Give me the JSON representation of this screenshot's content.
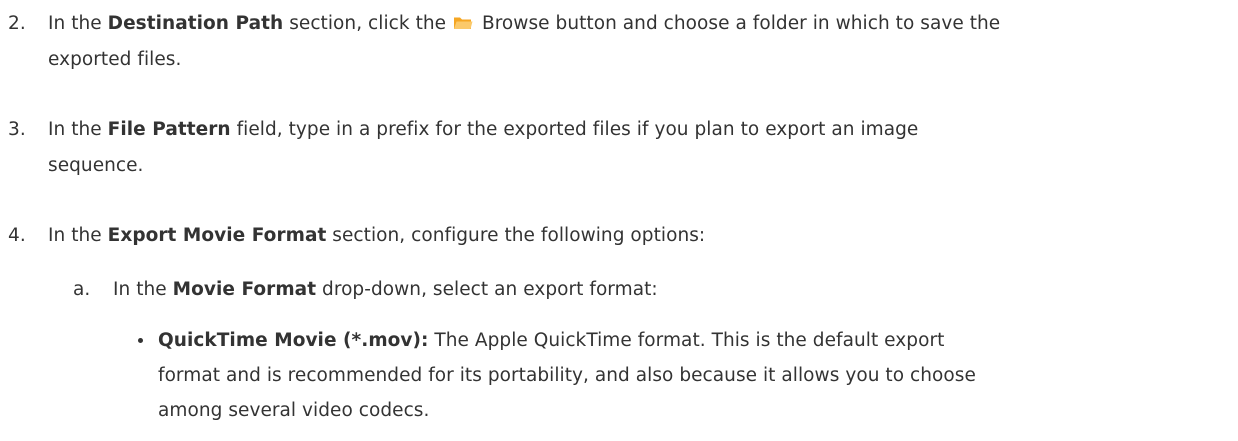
{
  "steps": [
    {
      "number": "2.",
      "pre": "In the ",
      "bold": "Destination Path",
      "mid": " section, click the ",
      "icon": "folder-icon",
      "post": " Browse button and choose a folder in which to save the",
      "continuation": "exported files."
    },
    {
      "number": "3.",
      "pre": "In the ",
      "bold": "File Pattern",
      "post": " field, type in a prefix for the exported files if you plan to export an image",
      "continuation": "sequence."
    },
    {
      "number": "4.",
      "pre": "In the ",
      "bold": "Export Movie Format",
      "post": " section, configure the following options:"
    }
  ],
  "substep": {
    "label": "a.",
    "pre": "In the ",
    "bold": "Movie Format",
    "post": " drop-down, select an export format:"
  },
  "bullet": {
    "bold": "QuickTime Movie (*.mov):",
    "line1": " The Apple QuickTime format. This is the default export",
    "line2": "format and is recommended for its portability, and also because it allows you to choose",
    "line3": "among several video codecs."
  },
  "colors": {
    "text": "#333333",
    "folder_body": "#f5a623",
    "folder_front": "#fbc96a"
  }
}
